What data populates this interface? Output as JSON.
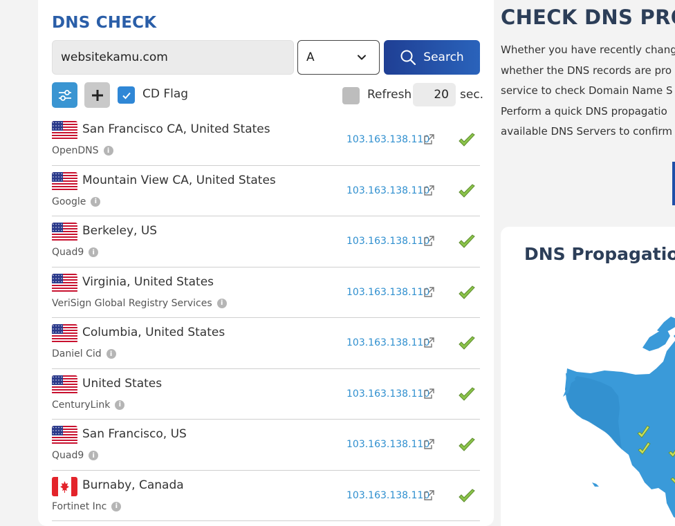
{
  "left_panel": {
    "title": "DNS CHECK",
    "domain_value": "websitekamu.com",
    "record_type": "A",
    "search_label": "Search",
    "cd_flag_label": "CD Flag",
    "refresh_label": "Refresh:",
    "refresh_value": "20",
    "refresh_unit": "sec."
  },
  "results": [
    {
      "flag": "us",
      "location": "San Francisco CA, United States",
      "provider": "OpenDNS",
      "ip": "103.163.138.110"
    },
    {
      "flag": "us",
      "location": "Mountain View CA, United States",
      "provider": "Google",
      "ip": "103.163.138.110"
    },
    {
      "flag": "us",
      "location": "Berkeley, US",
      "provider": "Quad9",
      "ip": "103.163.138.110"
    },
    {
      "flag": "us",
      "location": "Virginia, United States",
      "provider": "VeriSign Global Registry Services",
      "ip": "103.163.138.110"
    },
    {
      "flag": "us",
      "location": "Columbia, United States",
      "provider": "Daniel Cid",
      "ip": "103.163.138.110"
    },
    {
      "flag": "us",
      "location": "United States",
      "provider": "CenturyLink",
      "ip": "103.163.138.110"
    },
    {
      "flag": "us",
      "location": "San Francisco, US",
      "provider": "Quad9",
      "ip": "103.163.138.110"
    },
    {
      "flag": "ca",
      "location": "Burnaby, Canada",
      "provider": "Fortinet Inc",
      "ip": "103.163.138.110"
    }
  ],
  "right_panel": {
    "title": "CHECK DNS PRO",
    "paragraph_lines": [
      "Whether you have recently chang",
      "whether the DNS records are pro",
      "service to check Domain Name S",
      "Perform a quick DNS propagatio",
      "available DNS Servers to confirm"
    ],
    "map_title": "DNS Propagation"
  },
  "colors": {
    "accent": "#2a5ea8",
    "ip_link": "#2f8fcf",
    "check_green": "#8bc34a",
    "map_blue": "#3a9ad9"
  }
}
